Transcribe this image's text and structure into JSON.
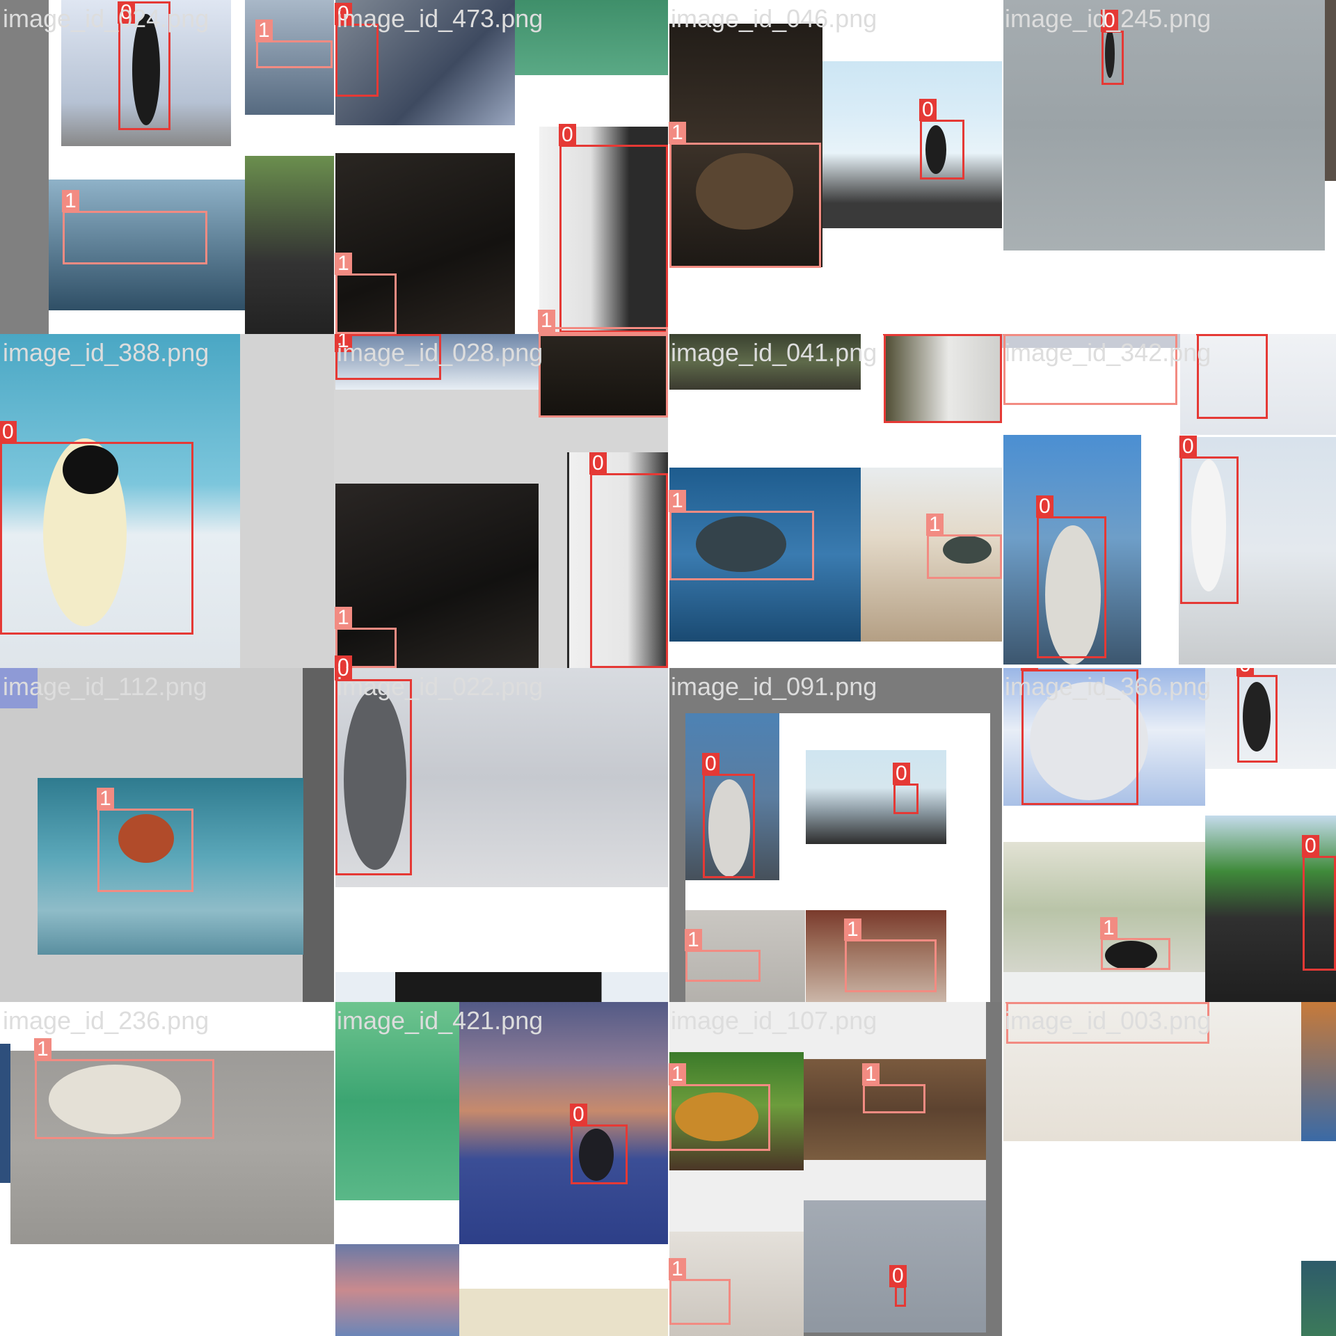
{
  "classes": {
    "0": "0",
    "1": "1"
  },
  "colors": {
    "class_0_box": "#e53935",
    "class_1_box": "#f28b82",
    "label_text": "#ffffff",
    "filename_text": "#dddddd"
  },
  "tiles": [
    {
      "name": "image_id_024.png",
      "boxes": [
        {
          "label": "0"
        },
        {
          "label": "1"
        },
        {
          "label": "1"
        }
      ]
    },
    {
      "name": "image_id_473.png",
      "boxes": [
        {
          "label": "0"
        },
        {
          "label": "0"
        },
        {
          "label": "1"
        },
        {
          "label": "1"
        }
      ]
    },
    {
      "name": "image_id_046.png",
      "boxes": [
        {
          "label": "1"
        },
        {
          "label": "0"
        }
      ]
    },
    {
      "name": "image_id_245.png",
      "boxes": [
        {
          "label": "0"
        }
      ]
    },
    {
      "name": "image_id_388.png",
      "boxes": [
        {
          "label": "0"
        }
      ]
    },
    {
      "name": "image_id_028.png",
      "boxes": [
        {
          "label": "1"
        },
        {
          "label": "0"
        },
        {
          "label": "1"
        },
        {
          "label": "0"
        }
      ]
    },
    {
      "name": "image_id_041.png",
      "boxes": [
        {
          "label": "0"
        },
        {
          "label": "1"
        },
        {
          "label": "1"
        }
      ]
    },
    {
      "name": "image_id_342.png",
      "boxes": [
        {
          "label": "1"
        },
        {
          "label": "0"
        },
        {
          "label": "0"
        },
        {
          "label": "0"
        }
      ]
    },
    {
      "name": "image_id_112.png",
      "boxes": [
        {
          "label": "1"
        }
      ]
    },
    {
      "name": "image_id_022.png",
      "boxes": [
        {
          "label": "0"
        }
      ]
    },
    {
      "name": "image_id_091.png",
      "boxes": [
        {
          "label": "0"
        },
        {
          "label": "0"
        },
        {
          "label": "1"
        },
        {
          "label": "1"
        }
      ]
    },
    {
      "name": "image_id_366.png",
      "boxes": [
        {
          "label": "0"
        },
        {
          "label": "0"
        },
        {
          "label": "0"
        },
        {
          "label": "1"
        }
      ]
    },
    {
      "name": "image_id_236.png",
      "boxes": [
        {
          "label": "1"
        }
      ]
    },
    {
      "name": "image_id_421.png",
      "boxes": [
        {
          "label": "0"
        }
      ]
    },
    {
      "name": "image_id_107.png",
      "boxes": [
        {
          "label": "1"
        },
        {
          "label": "1"
        },
        {
          "label": "1"
        },
        {
          "label": "0"
        }
      ]
    },
    {
      "name": "image_id_003.png",
      "boxes": [
        {
          "label": "1"
        }
      ]
    }
  ]
}
